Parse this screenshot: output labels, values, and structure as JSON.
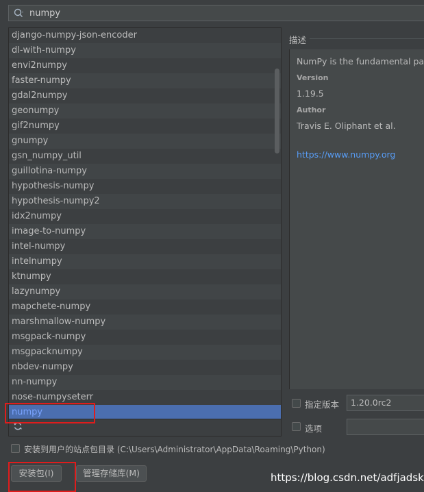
{
  "search": {
    "value": "numpy"
  },
  "packages": [
    "django-numpy-json-encoder",
    "dl-with-numpy",
    "envi2numpy",
    "faster-numpy",
    "gdal2numpy",
    "geonumpy",
    "gif2numpy",
    "gnumpy",
    "gsn_numpy_util",
    "guillotina-numpy",
    "hypothesis-numpy",
    "hypothesis-numpy2",
    "idx2numpy",
    "image-to-numpy",
    "intel-numpy",
    "intelnumpy",
    "ktnumpy",
    "lazynumpy",
    "mapchete-numpy",
    "marshmallow-numpy",
    "msgpack-numpy",
    "msgpacknumpy",
    "nbdev-numpy",
    "nn-numpy",
    "nose-numpyseterr",
    "numpy"
  ],
  "selected_package": "numpy",
  "description": {
    "title": "描述",
    "summary": "NumPy is the fundamental package",
    "version_label": "Version",
    "version": "1.19.5",
    "author_label": "Author",
    "author": "Travis E. Oliphant et al.",
    "url": "https://www.numpy.org"
  },
  "options": {
    "specify_version_label": "指定版本",
    "specify_version_value": "1.20.0rc2",
    "options_label": "选项",
    "options_value": "",
    "install_user_site_label": "安装到用户的站点包目录 (C:\\Users\\Administrator\\AppData\\Roaming\\Python)"
  },
  "buttons": {
    "install": "安装包(I)",
    "manage_repos": "管理存储库(M)"
  },
  "watermark": "https://blog.csdn.net/adfjadsklf",
  "colors": {
    "background": "#3c3f41",
    "selection": "#4b6eaf",
    "link": "#589df6",
    "annotation_red": "#e01c1c"
  }
}
